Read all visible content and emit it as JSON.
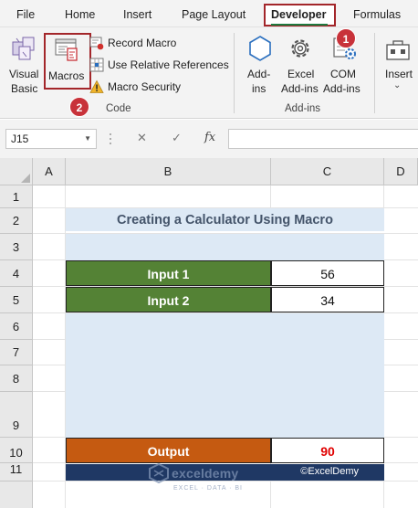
{
  "ribbon": {
    "tabs": [
      "File",
      "Home",
      "Insert",
      "Page Layout",
      "Developer",
      "Formulas"
    ],
    "active_tab": "Developer",
    "code_group": {
      "visual_basic": [
        "Visual",
        "Basic"
      ],
      "macros": "Macros",
      "record_macro": "Record Macro",
      "relative_refs": "Use Relative References",
      "macro_security": "Macro Security",
      "label": "Code"
    },
    "addins_group": {
      "addins": [
        "Add-",
        "ins"
      ],
      "excel_addins": [
        "Excel",
        "Add-ins"
      ],
      "com_addins": [
        "COM",
        "Add-ins"
      ],
      "label": "Add-ins"
    },
    "controls_group": {
      "insert": "Insert",
      "insert_caret": "⌄"
    },
    "badges": [
      "1",
      "2"
    ]
  },
  "formula_bar": {
    "name_box": "J15",
    "cancel": "✕",
    "enter": "✓",
    "fx": "fx",
    "value": ""
  },
  "sheet": {
    "columns": [
      "A",
      "B",
      "C",
      "D"
    ],
    "rows": [
      "1",
      "2",
      "3",
      "4",
      "5",
      "6",
      "7",
      "8",
      "9",
      "10",
      "11"
    ],
    "title": "Creating a Calculator Using Macro",
    "inputs": [
      {
        "label": "Input 1",
        "value": "56"
      },
      {
        "label": "Input 2",
        "value": "34"
      }
    ],
    "output": {
      "label": "Output",
      "value": "90"
    },
    "footer_copyright": "©ExcelDemy",
    "watermark": {
      "name": "exceldemy",
      "tagline": "EXCEL · DATA · BI"
    }
  },
  "colors": {
    "accent_red": "#a3262a",
    "input_green": "#548235",
    "output_orange": "#c55a11",
    "title_fill": "#dde9f5",
    "footer_navy": "#1f3864",
    "output_value": "#e00000"
  }
}
